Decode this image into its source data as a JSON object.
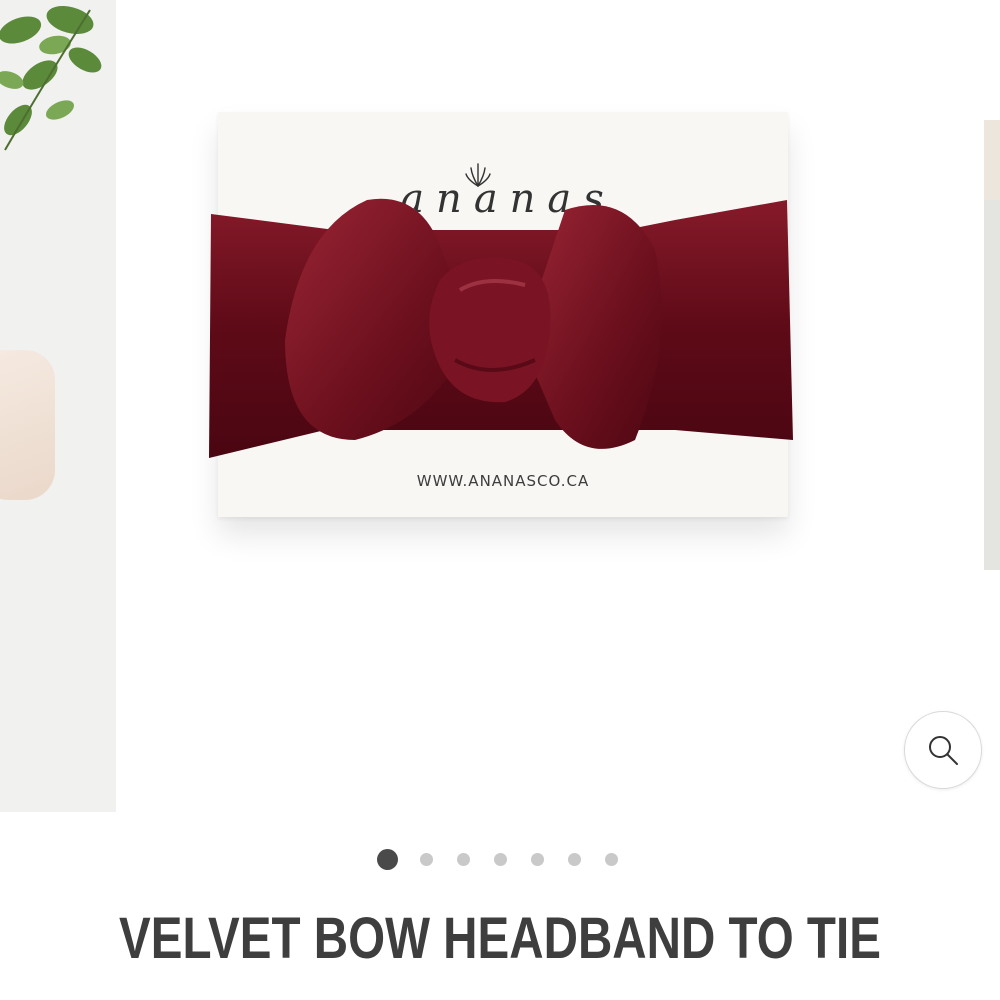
{
  "carousel": {
    "card": {
      "brand_name": "ananas",
      "url": "WWW.ANANASCO.CA"
    },
    "zoom_button": {
      "icon": "zoom-icon"
    },
    "pagination": {
      "total": 7,
      "active_index": 0
    }
  },
  "product": {
    "title": "VELVET BOW HEADBAND TO TIE"
  },
  "colors": {
    "velvet": "#6e0f1c",
    "title": "#3e3e3e",
    "dot_active": "#4a4a4a",
    "dot_inactive": "#c9c9c9"
  }
}
